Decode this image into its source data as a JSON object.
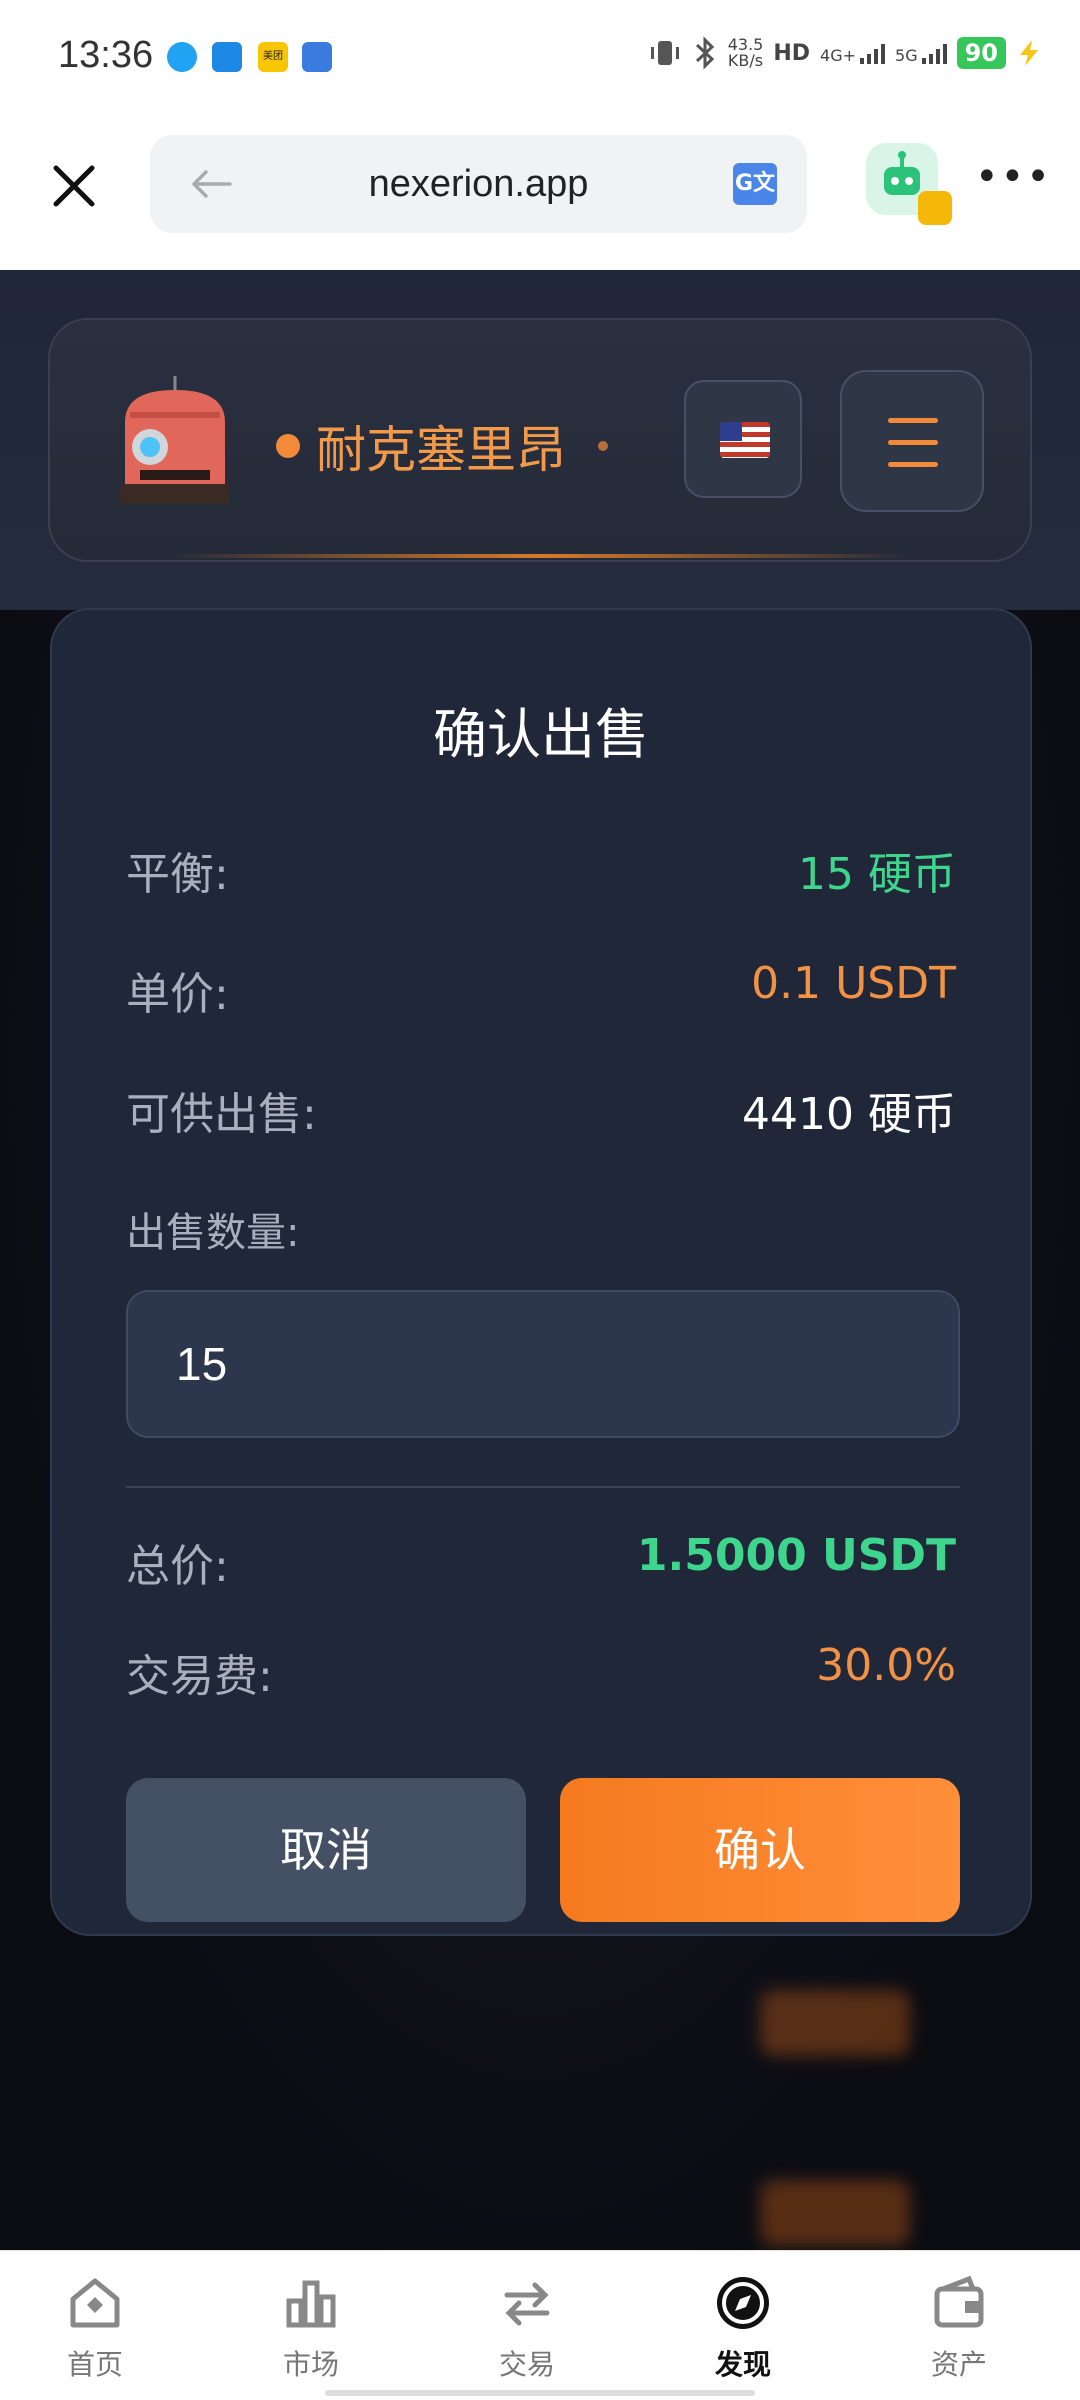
{
  "status_bar": {
    "time": "13:36",
    "net_speed": "43.5",
    "net_unit": "KB/s",
    "hd_label": "HD",
    "net_4g": "4G+",
    "net_5g": "5G",
    "battery": "90",
    "notif_meituan": "美团"
  },
  "browser": {
    "url": "nexerion.app",
    "translate_icon": "G文"
  },
  "header": {
    "brand": "耐克塞里昂",
    "logo_text": "MINING MACHINE"
  },
  "modal": {
    "title": "确认出售",
    "balance_label": "平衡:",
    "balance_value": "15 硬币",
    "price_label": "单价:",
    "price_value": "0.1 USDT",
    "available_label": "可供出售:",
    "available_value": "4410 硬币",
    "qty_label": "出售数量:",
    "qty_value": "15",
    "total_label": "总价:",
    "total_value": "1.5000 USDT",
    "fee_label": "交易费:",
    "fee_value": "30.0%",
    "cancel": "取消",
    "confirm": "确认"
  },
  "nav": [
    {
      "label": "首页",
      "icon": "home-icon"
    },
    {
      "label": "市场",
      "icon": "chart-icon"
    },
    {
      "label": "交易",
      "icon": "swap-icon"
    },
    {
      "label": "发现",
      "icon": "compass-icon",
      "active": true
    },
    {
      "label": "资产",
      "icon": "wallet-icon"
    }
  ],
  "colors": {
    "accent": "#f28a3a",
    "green": "#3dd68c",
    "modal_bg": "#1f2739"
  }
}
